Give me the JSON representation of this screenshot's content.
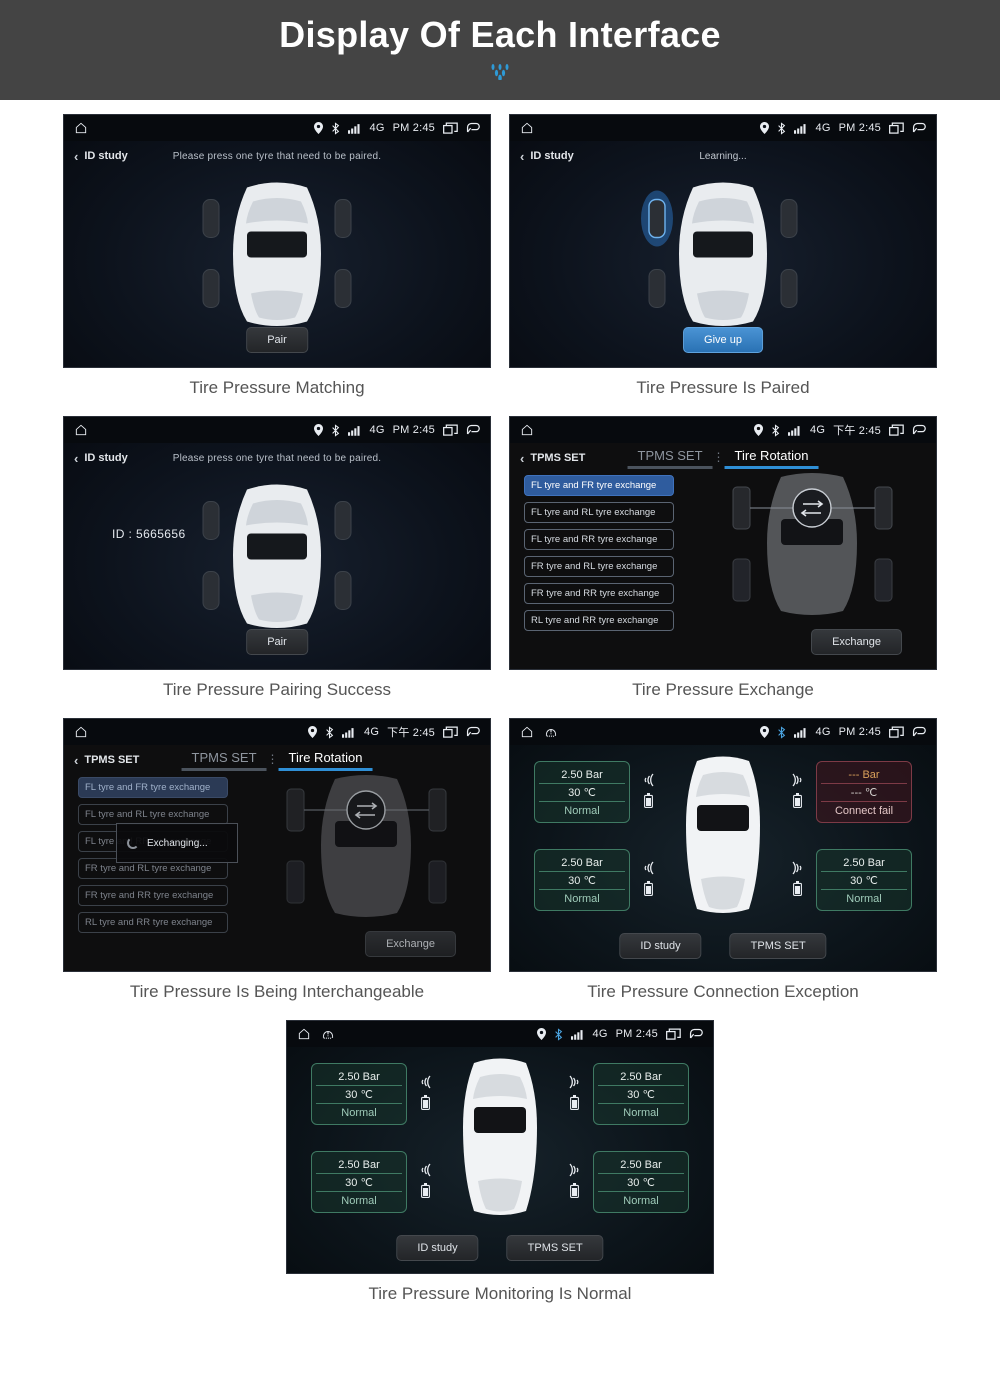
{
  "banner": {
    "title": "Display Of Each Interface",
    "accent_color": "#2e9ad6",
    "bg_color": "#444444"
  },
  "statusbar_common": {
    "location_icon": "location-pin-icon",
    "bluetooth_icon": "bluetooth-icon",
    "signal_icon": "signal-bars-icon",
    "network": "4G",
    "recents_icon": "recent-apps-icon",
    "back_icon": "back-arrow-icon",
    "home_icon": "home-icon",
    "tpms_warning_icon": "tpms-warning-icon"
  },
  "panels": [
    {
      "id": "tire-pressure-matching",
      "caption": "Tire Pressure Matching",
      "statusbar": {
        "time": "PM 2:45",
        "network": "4G"
      },
      "back_label": "ID study",
      "hint": "Please press one tyre that need to be paired.",
      "button": "Pair"
    },
    {
      "id": "tire-pressure-is-paired",
      "caption": "Tire Pressure Is Paired",
      "statusbar": {
        "time": "PM 2:45",
        "network": "4G"
      },
      "back_label": "ID study",
      "hint": "Learning...",
      "button": "Give up"
    },
    {
      "id": "tire-pressure-pairing-success",
      "caption": "Tire Pressure Pairing Success",
      "statusbar": {
        "time": "PM 2:45",
        "network": "4G"
      },
      "back_label": "ID study",
      "hint": "Please press one tyre that need to be paired.",
      "id_value": "ID : 5665656",
      "button": "Pair"
    },
    {
      "id": "tire-pressure-exchange",
      "caption": "Tire Pressure Exchange",
      "statusbar": {
        "time": "下午 2:45",
        "network": "4G"
      },
      "back_label": "TPMS SET",
      "tabs": [
        {
          "label": "TPMS SET",
          "active": false
        },
        {
          "label": "Tire Rotation",
          "active": true
        }
      ],
      "exchange_options": [
        "FL tyre and FR tyre exchange",
        "FL tyre and RL tyre exchange",
        "FL tyre and RR tyre exchange",
        "FR tyre and RL tyre exchange",
        "FR tyre and RR tyre exchange",
        "RL tyre and RR tyre exchange"
      ],
      "selected_option_index": 0,
      "button": "Exchange"
    },
    {
      "id": "tire-pressure-is-being-interchangeable",
      "caption": "Tire Pressure Is Being Interchangeable",
      "statusbar": {
        "time": "下午 2:45",
        "network": "4G"
      },
      "back_label": "TPMS SET",
      "tabs": [
        {
          "label": "TPMS SET",
          "active": false
        },
        {
          "label": "Tire Rotation",
          "active": true
        }
      ],
      "exchange_options": [
        "FL tyre and FR tyre exchange",
        "FL tyre and RL tyre exchange",
        "FL tyre and RR tyre exchange",
        "FR tyre and RL tyre exchange",
        "FR tyre and RR tyre exchange",
        "RL tyre and RR tyre exchange"
      ],
      "selected_option_index": 0,
      "dialog": "Exchanging...",
      "button": "Exchange"
    },
    {
      "id": "tire-pressure-connection-exception",
      "caption": "Tire Pressure Connection Exception",
      "statusbar": {
        "time": "PM 2:45",
        "network": "4G"
      },
      "tires": [
        {
          "pos": "front-left",
          "pressure": "2.50  Bar",
          "temperature": "30  ℃",
          "status": "Normal",
          "state": "normal"
        },
        {
          "pos": "front-right",
          "pressure": "---  Bar",
          "temperature": "---  ℃",
          "status": "Connect fail",
          "state": "fail"
        },
        {
          "pos": "rear-left",
          "pressure": "2.50  Bar",
          "temperature": "30  ℃",
          "status": "Normal",
          "state": "normal"
        },
        {
          "pos": "rear-right",
          "pressure": "2.50  Bar",
          "temperature": "30  ℃",
          "status": "Normal",
          "state": "normal"
        }
      ],
      "buttons": [
        "ID study",
        "TPMS SET"
      ]
    },
    {
      "id": "tire-pressure-monitoring-is-normal",
      "caption": "Tire Pressure Monitoring Is Normal",
      "statusbar": {
        "time": "PM 2:45",
        "network": "4G"
      },
      "tires": [
        {
          "pos": "front-left",
          "pressure": "2.50  Bar",
          "temperature": "30  ℃",
          "status": "Normal",
          "state": "normal"
        },
        {
          "pos": "front-right",
          "pressure": "2.50  Bar",
          "temperature": "30  ℃",
          "status": "Normal",
          "state": "normal"
        },
        {
          "pos": "rear-left",
          "pressure": "2.50  Bar",
          "temperature": "30  ℃",
          "status": "Normal",
          "state": "normal"
        },
        {
          "pos": "rear-right",
          "pressure": "2.50  Bar",
          "temperature": "30  ℃",
          "status": "Normal",
          "state": "normal"
        }
      ],
      "buttons": [
        "ID study",
        "TPMS SET"
      ]
    }
  ]
}
